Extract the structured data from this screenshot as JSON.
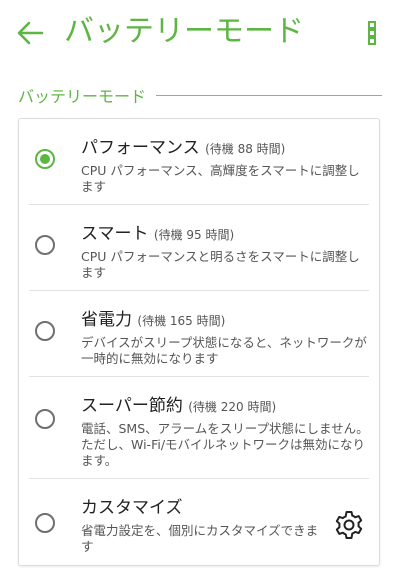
{
  "appbar": {
    "title": "バッテリーモード",
    "icons": {
      "back": "arrow-left-icon",
      "menu": "more-vertical-icon"
    }
  },
  "section": {
    "title": "バッテリーモード"
  },
  "options": [
    {
      "title": "パフォーマンス",
      "standby": "(待機 88 時間)",
      "description": "CPU パフォーマンス、高輝度をスマートに調整します",
      "selected": true
    },
    {
      "title": "スマート",
      "standby": "(待機 95 時間)",
      "description": "CPU パフォーマンスと明るさをスマートに調整します",
      "selected": false
    },
    {
      "title": "省電力",
      "standby": "(待機 165 時間)",
      "description": "デバイスがスリープ状態になると、ネットワークが一時的に無効になります",
      "selected": false
    },
    {
      "title": "スーパー節約",
      "standby": "(待機 220 時間)",
      "description": "電話、SMS、アラームをスリープ状態にしません。ただし、Wi-Fi/モバイルネットワークは無効になります。",
      "selected": false
    },
    {
      "title": "カスタマイズ",
      "standby": "",
      "description": "省電力設定を、個別にカスタマイズできます",
      "selected": false,
      "icon": "gear-icon"
    }
  ],
  "colors": {
    "accent": "#5db643",
    "text_primary": "#222222",
    "text_secondary": "#555555",
    "divider": "#e2e2e2"
  }
}
